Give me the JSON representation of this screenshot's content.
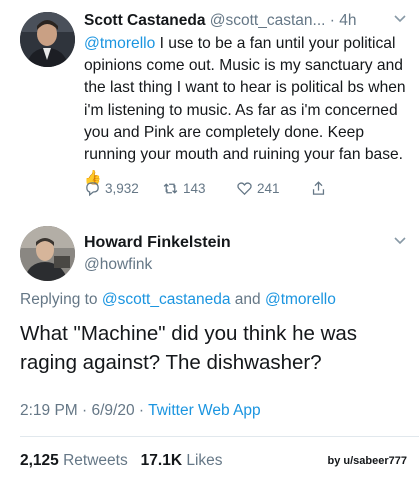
{
  "tweet": {
    "author_name": "Scott Castaneda",
    "author_handle": "@scott_castan...",
    "time": "· 4h",
    "mention": "@tmorello",
    "text": " I use to be a fan until your political opinions come out. Music is my sanctuary and the last thing I want to hear is political bs when i'm listening to music. As far as i'm concerned you and Pink are completely done. Keep running your mouth and ruining your fan base.",
    "emoji": "👍",
    "replies": "3,932",
    "retweets": "143",
    "likes": "241"
  },
  "reply": {
    "author_name": "Howard Finkelstein",
    "author_handle": "@howfink",
    "replying_prefix": "Replying to",
    "replying_user1": "@scott_castaneda",
    "replying_and": "and",
    "replying_user2": "@tmorello",
    "text": "What \"Machine\" did you think he was raging against? The dishwasher?",
    "timestamp": "2:19 PM · 6/9/20 · ",
    "source": "Twitter Web App",
    "retweet_count": "2,125",
    "retweet_label": "Retweets",
    "like_count": "17.1K",
    "like_label": "Likes"
  },
  "credit": "by u/sabeer777",
  "colors": {
    "link": "#1b95e0",
    "muted": "#657786",
    "text": "#14171a"
  }
}
